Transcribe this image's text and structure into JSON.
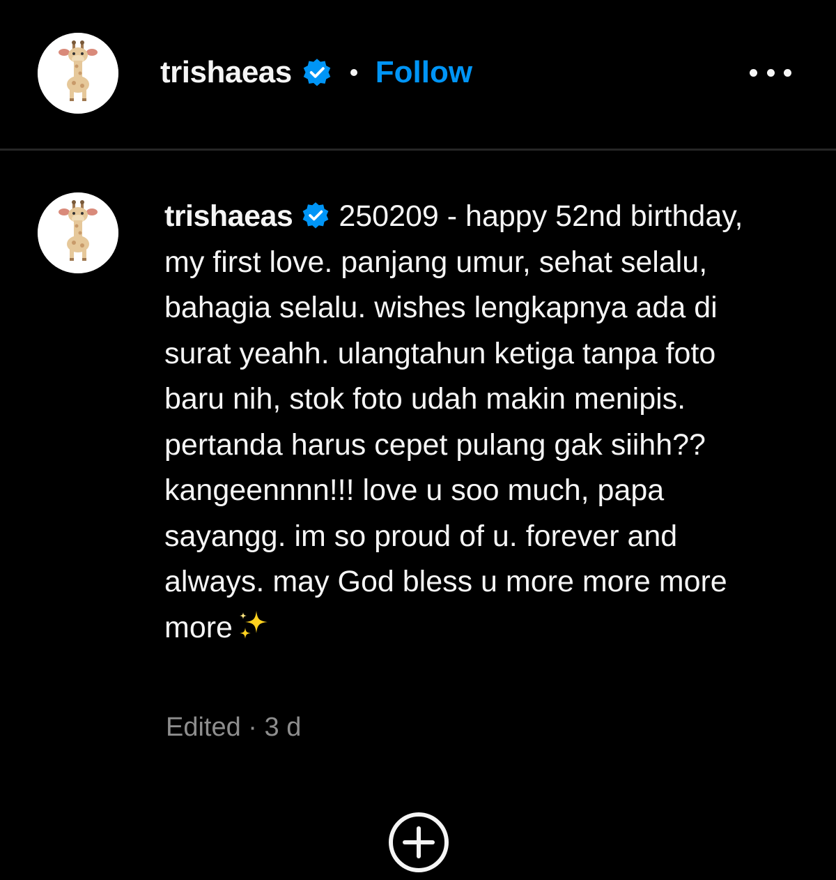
{
  "header": {
    "username": "trishaeas",
    "verified": true,
    "separator": "•",
    "follow_label": "Follow",
    "more_icon": "more-horizontal-icon"
  },
  "comment": {
    "username": "trishaeas",
    "verified": true,
    "text": "250209 - happy 52nd birthday, my first love. panjang umur, sehat selalu, bahagia selalu. wishes lengkapnya ada di surat yeahh. ulangtahun ketiga tanpa foto baru nih, stok foto udah makin menipis. pertanda harus cepet pulang gak siihh?? kangeennnn!!! love u soo much, papa sayangg. im so proud of u. forever and always. may God bless u more more more more",
    "emoji": "sparkles-icon",
    "meta": "Edited · 3 d"
  },
  "footer": {
    "add_icon": "plus-circle-icon"
  },
  "colors": {
    "background": "#000000",
    "text": "#f5f5f5",
    "accent": "#0095f6",
    "muted": "#8e8e8e",
    "divider": "#262626"
  }
}
